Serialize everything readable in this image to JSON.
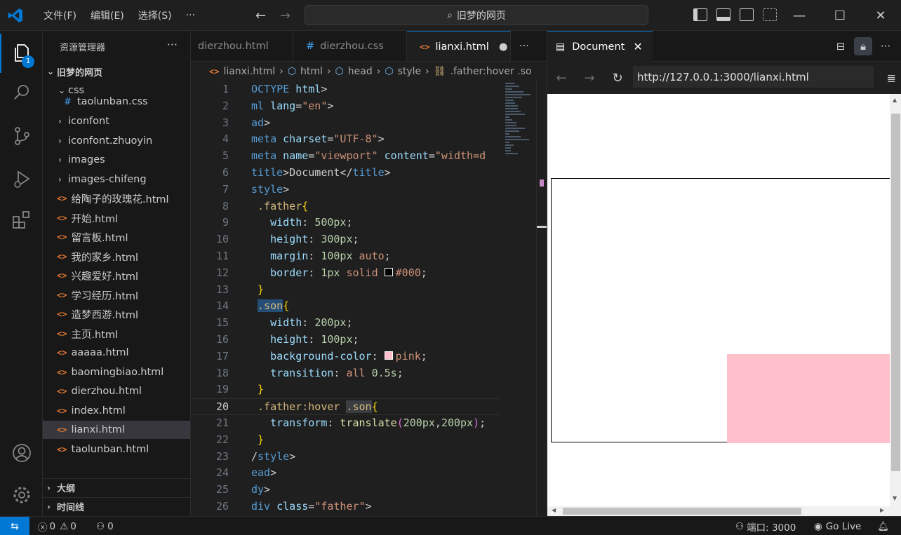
{
  "titlebar": {
    "menu": [
      "文件(F)",
      "编辑(E)",
      "选择(S)",
      "···"
    ],
    "search": "旧梦的网页",
    "nav_back": "←",
    "nav_forward": "→"
  },
  "activity": {
    "badge": "1"
  },
  "sidebar": {
    "title": "资源管理器",
    "more": "···",
    "root": "旧梦的网页",
    "items": [
      {
        "label": "css",
        "kind": "folder-open"
      },
      {
        "label": "taolunban.css",
        "kind": "css"
      },
      {
        "label": "iconfont",
        "kind": "folder"
      },
      {
        "label": "iconfont.zhuoyin",
        "kind": "folder"
      },
      {
        "label": "images",
        "kind": "folder"
      },
      {
        "label": "images-chifeng",
        "kind": "folder"
      },
      {
        "label": "给陶子的玫瑰花.html",
        "kind": "html"
      },
      {
        "label": "开始.html",
        "kind": "html"
      },
      {
        "label": "留言板.html",
        "kind": "html"
      },
      {
        "label": "我的家乡.html",
        "kind": "html"
      },
      {
        "label": "兴趣爱好.html",
        "kind": "html"
      },
      {
        "label": "学习经历.html",
        "kind": "html"
      },
      {
        "label": "造梦西游.html",
        "kind": "html"
      },
      {
        "label": "主页.html",
        "kind": "html"
      },
      {
        "label": "aaaaa.html",
        "kind": "html"
      },
      {
        "label": "baomingbiao.html",
        "kind": "html"
      },
      {
        "label": "dierzhou.html",
        "kind": "html"
      },
      {
        "label": "index.html",
        "kind": "html"
      },
      {
        "label": "lianxi.html",
        "kind": "html",
        "selected": true
      },
      {
        "label": "taolunban.html",
        "kind": "html"
      }
    ],
    "outline": "大纲",
    "timeline": "时间线"
  },
  "editor": {
    "tabs": [
      {
        "label": "dierzhou.html",
        "icon": "<>"
      },
      {
        "label": "dierzhou.css",
        "icon": "#"
      },
      {
        "label": "lianxi.html",
        "icon": "<>",
        "active": true
      }
    ],
    "tabs_more": "···",
    "breadcrumb": [
      "lianxi.html",
      "html",
      "head",
      "style",
      ".father:hover .so"
    ],
    "current_line": 20
  },
  "preview": {
    "tab": "Document",
    "url": "http://127.0.0.1:3000/lianxi.html",
    "son_color": "#ffc0cb"
  },
  "statusbar": {
    "errors": "0",
    "warnings": "0",
    "ports": "0",
    "port": "端口: 3000",
    "golive": "Go Live"
  },
  "colors": {
    "accent": "#0078d4",
    "pink": "#ffc0cb"
  }
}
